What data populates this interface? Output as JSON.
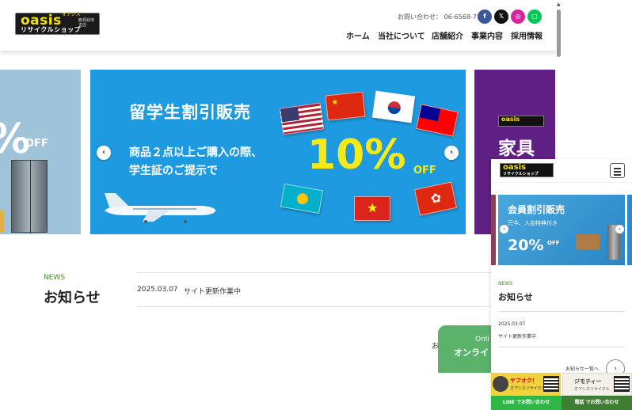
{
  "header": {
    "logo_word": "oasis",
    "logo_kana": "オアシス",
    "logo_branch": "鶴見緑地 支店",
    "logo_sub": "リサイクルショップ",
    "contact_label": "お問い合わせ：",
    "contact_phone": "06-6568-7179",
    "social": [
      {
        "icon": "facebook-icon",
        "glyph": "f",
        "color": "#3b5998"
      },
      {
        "icon": "x-icon",
        "glyph": "𝕏",
        "color": "#111111"
      },
      {
        "icon": "instagram-icon",
        "glyph": "◎",
        "color": "#d6249f"
      },
      {
        "icon": "line-icon",
        "glyph": "▢",
        "color": "#06c755"
      }
    ],
    "nav": [
      "ホーム",
      "当社について",
      "店舗紹介",
      "事業内容",
      "採用情報"
    ]
  },
  "slider": {
    "left": {
      "pct": "%",
      "off": "OFF"
    },
    "main": {
      "title": "留学生割引販売",
      "subtitle": "商品２点以上ご購入の際、\n学生証のご提示で",
      "pct": "10%",
      "off": "OFF"
    },
    "right": {
      "logo": "oasis",
      "headline": "家具"
    },
    "prev": "‹",
    "next": "›"
  },
  "news": {
    "label": "NEWS",
    "title": "お知らせ",
    "items": [
      {
        "date": "2025.03.07",
        "text": "サイト更新作業中"
      }
    ],
    "more": "お",
    "online_a": "Onli",
    "online_b": "オンライ"
  },
  "mobile": {
    "logo_word": "oasis",
    "logo_sub": "リサイクルショップ",
    "banner_title": "会員割引販売",
    "banner_sub": "只今、入会特典付き",
    "banner_pct": "20%",
    "banner_off": "OFF",
    "news_label": "NEWS",
    "news_title": "お知らせ",
    "news_date": "2025.03.07",
    "news_text": "サイト更新作業中",
    "more": "お知らせ一覧へ",
    "ad_yahoo": "ヤフオク!",
    "ad_yahoo_sub": "オアシスリサイクル",
    "ad_jimoty": "ジモティー",
    "ad_jimoty_sub": "オアシスリサイクル",
    "cta_line": "LINE でお問い合わせ",
    "cta_tel": "電話 でお問い合わせ"
  },
  "colors": {
    "accent_blue": "#1e9be0",
    "accent_green": "#4a8a2a",
    "yellow": "#f7e916",
    "purple": "#5f1f84"
  }
}
